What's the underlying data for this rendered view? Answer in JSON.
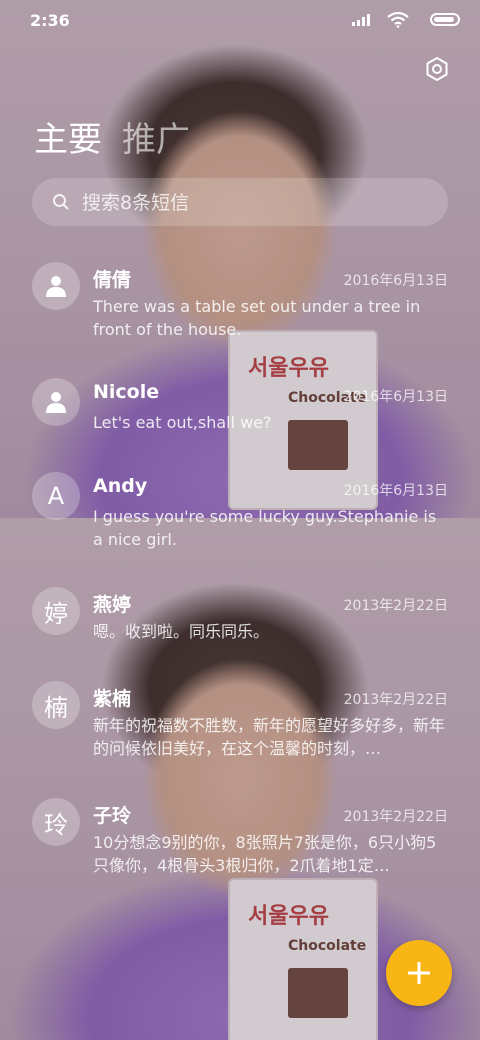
{
  "status_bar": {
    "time": "2:36"
  },
  "header": {
    "tabs": [
      {
        "label": "主要"
      },
      {
        "label": "推广"
      }
    ]
  },
  "search": {
    "placeholder": "搜索8条短信"
  },
  "messages": [
    {
      "avatar": "person-icon",
      "avatar_text": "",
      "name": "倩倩",
      "date": "2016年6月13日",
      "preview": "There was a table set out under a tree in front of the house."
    },
    {
      "avatar": "person-icon",
      "avatar_text": "",
      "name": "Nicole",
      "date": "2016年6月13日",
      "preview": "Let's eat out,shall we?"
    },
    {
      "avatar": "letter",
      "avatar_text": "A",
      "name": "Andy",
      "date": "2016年6月13日",
      "preview": "I guess you're some lucky guy.Stephanie is a nice girl."
    },
    {
      "avatar": "letter",
      "avatar_text": "婷",
      "name": "燕婷",
      "date": "2013年2月22日",
      "preview": "嗯。收到啦。同乐同乐。"
    },
    {
      "avatar": "letter",
      "avatar_text": "楠",
      "name": "紫楠",
      "date": "2013年2月22日",
      "preview": "新年的祝福数不胜数，新年的愿望好多好多，新年的问候依旧美好，在这个温馨的时刻，…"
    },
    {
      "avatar": "letter",
      "avatar_text": "玲",
      "name": "子玲",
      "date": "2013年2月22日",
      "preview": "10分想念9别的你，8张照片7张是你，6只小狗5只像你，4根骨头3根归你，2爪着地1定…"
    }
  ],
  "fab": {
    "icon": "plus-icon"
  },
  "colors": {
    "accent": "#f8b615"
  }
}
